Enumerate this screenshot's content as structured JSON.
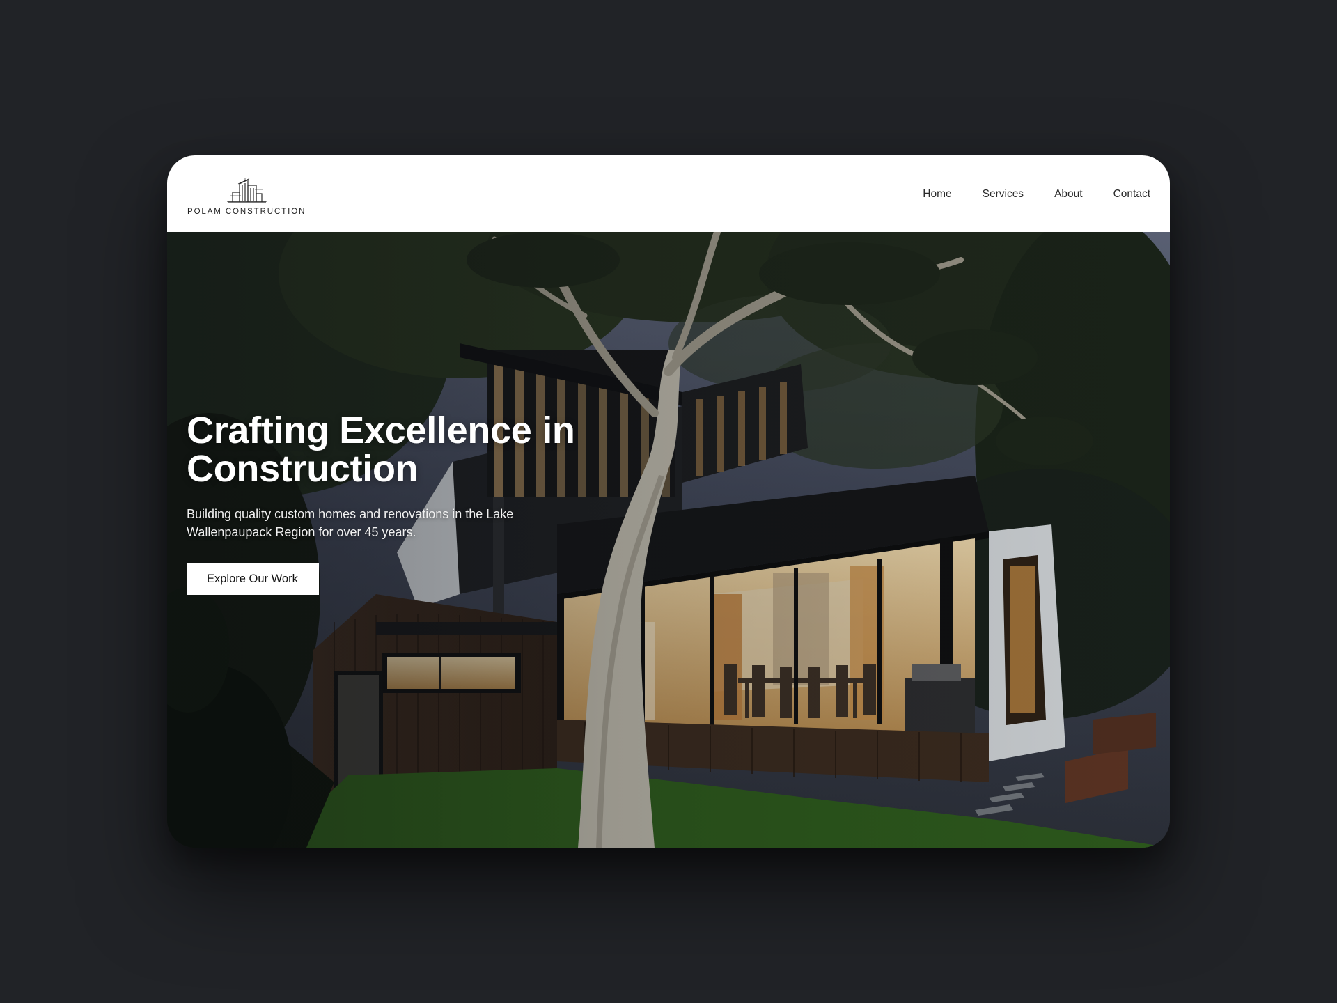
{
  "brand": {
    "name": "POLAM CONSTRUCTION",
    "logo_icon": "building-outline-icon"
  },
  "nav": {
    "items": [
      {
        "label": "Home"
      },
      {
        "label": "Services"
      },
      {
        "label": "About"
      },
      {
        "label": "Contact"
      }
    ]
  },
  "hero": {
    "title_line1": "Crafting Excellence in",
    "title_line2": "Construction",
    "subtitle": "Building quality custom homes and renovations in the Lake Wallenpaupack Region for over 45 years.",
    "cta_label": "Explore Our Work",
    "image": "modern-house-at-dusk-photo"
  },
  "colors": {
    "page_background": "#212327",
    "navbar_background": "#ffffff",
    "hero_text": "#ffffff",
    "cta_background": "#ffffff",
    "cta_text": "#111111"
  }
}
